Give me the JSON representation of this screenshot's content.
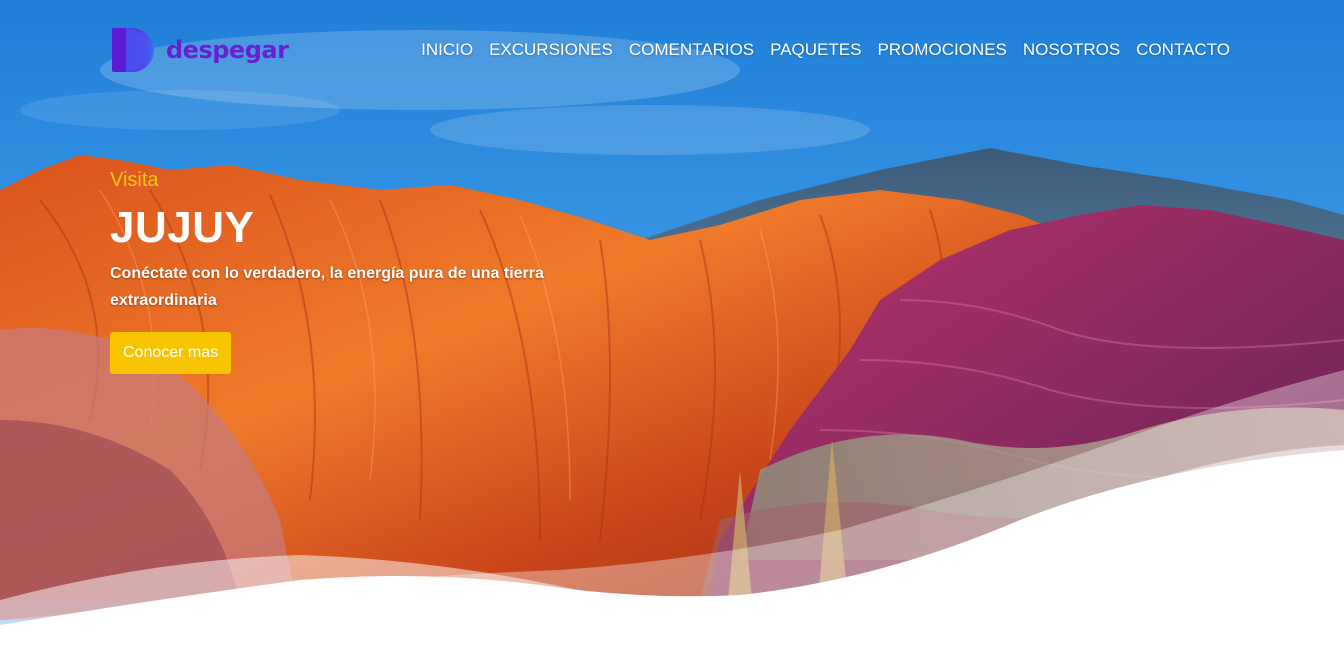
{
  "brand": {
    "name": "despegar"
  },
  "nav": {
    "items": [
      "INICIO",
      "EXCURSIONES",
      "COMENTARIOS",
      "PAQUETES",
      "PROMOCIONES",
      "NOSOTROS",
      "CONTACTO"
    ]
  },
  "hero": {
    "kicker": "Visita",
    "title": "JUJUY",
    "subtitle": "Conéctate con lo verdadero, la energía pura de una tierra extraordinaria",
    "cta_label": "Conocer mas"
  },
  "colors": {
    "brand_purple": "#6a1fd1",
    "brand_blue": "#3d3cf0",
    "accent_yellow": "#f7c400",
    "sky_blue": "#2f8ee0"
  }
}
